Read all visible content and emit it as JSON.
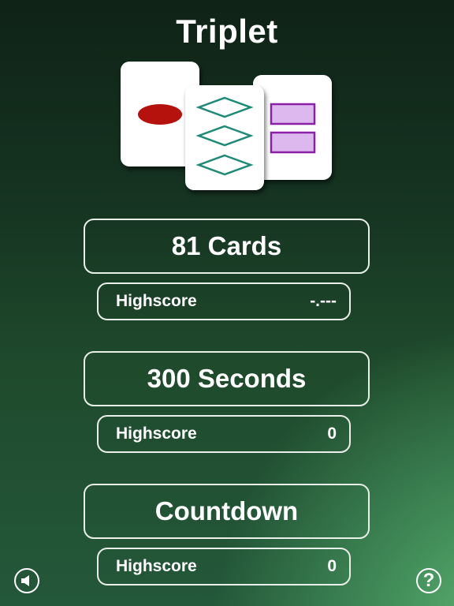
{
  "app": {
    "title": "Triplet"
  },
  "logo": {
    "card1": {
      "shape": "oval",
      "count": 1,
      "color": "#b5120e",
      "fill": "solid"
    },
    "card2": {
      "shape": "diamond",
      "count": 3,
      "color": "#1e8a78",
      "fill": "open"
    },
    "card3": {
      "shape": "rectangle",
      "count": 2,
      "color": "#8a1fa8",
      "fill": "shaded",
      "fill_color": "#ddb8ee"
    }
  },
  "modes": [
    {
      "label": "81 Cards",
      "score_label": "Highscore",
      "score_value": "-.---"
    },
    {
      "label": "300 Seconds",
      "score_label": "Highscore",
      "score_value": "0"
    },
    {
      "label": "Countdown",
      "score_label": "Highscore",
      "score_value": "0"
    }
  ],
  "controls": {
    "sound_icon": "speaker-icon",
    "help_icon": "question-icon",
    "help_glyph": "?"
  }
}
